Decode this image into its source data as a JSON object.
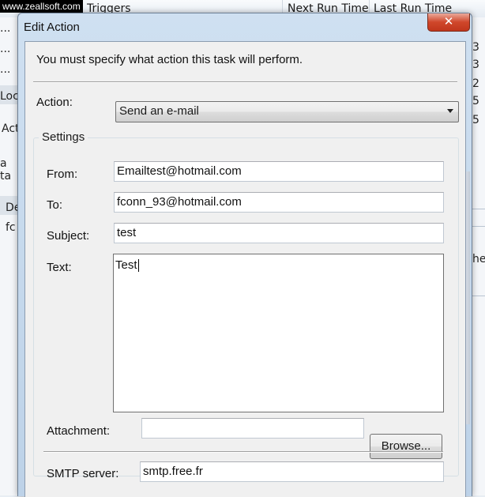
{
  "watermark": "www.zeallsoft.com",
  "background_window": {
    "columns": [
      "Triggers",
      "Next Run Time",
      "Last Run Time"
    ],
    "left_fragments": [
      "...",
      "...",
      "...",
      "Loc",
      "Act",
      "a ta",
      "De",
      "fc"
    ],
    "right_fragments": [
      "3",
      "3",
      "2",
      "5",
      "5",
      "he"
    ]
  },
  "dialog": {
    "title": "Edit Action",
    "close_symbol": "✕",
    "instruction": "You must specify what action this task will perform.",
    "action": {
      "label": "Action:",
      "value": "Send an e-mail"
    },
    "settings": {
      "legend": "Settings",
      "from": {
        "label": "From:",
        "value": "Emailtest@hotmail.com"
      },
      "to": {
        "label": "To:",
        "value": "fconn_93@hotmail.com"
      },
      "subject": {
        "label": "Subject:",
        "value": "test"
      },
      "text": {
        "label": "Text:",
        "value": "Test"
      },
      "attachment": {
        "label": "Attachment:",
        "value": "",
        "browse_label": "Browse..."
      }
    },
    "smtp": {
      "label": "SMTP server:",
      "value": "smtp.free.fr"
    }
  }
}
